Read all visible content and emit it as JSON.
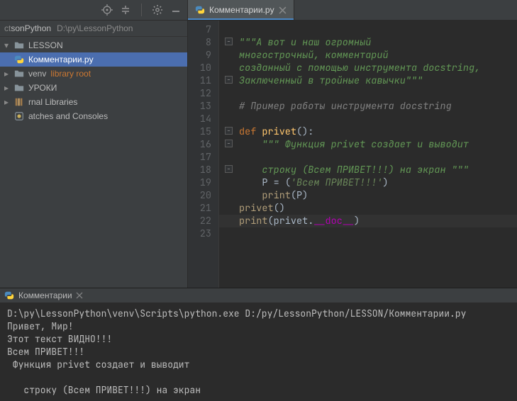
{
  "toolbar": {
    "icons": [
      "target-icon",
      "collapse-icon",
      "divider",
      "gear-icon",
      "minimize-icon"
    ]
  },
  "breadcrumb": {
    "prefix": "ct ",
    "project": "sonPython",
    "path": "D:\\py\\LessonPython"
  },
  "tree": {
    "items": [
      {
        "kind": "folder",
        "label": "LESSON",
        "arrow": "▾"
      },
      {
        "kind": "pyfile",
        "label": "Комментарии.py",
        "selected": true
      },
      {
        "kind": "venv",
        "label": "venv",
        "suffix": "library root",
        "arrow": "▸"
      },
      {
        "kind": "folder",
        "label": "УРОКИ",
        "arrow": "▸"
      },
      {
        "kind": "lib",
        "label": "rnal Libraries",
        "arrow": "▸"
      },
      {
        "kind": "scratch",
        "label": "atches and Consoles"
      }
    ]
  },
  "tab": {
    "label": "Комментарии.py"
  },
  "gutter_start": 7,
  "code_lines": [
    {
      "n": 7,
      "tokens": []
    },
    {
      "n": 8,
      "fold": "-",
      "tokens": [
        [
          "docstr",
          "\"\"\"А вот и наш огромный"
        ]
      ]
    },
    {
      "n": 9,
      "tokens": [
        [
          "docstr",
          "многострочный, комментарий"
        ]
      ]
    },
    {
      "n": 10,
      "tokens": [
        [
          "docstr",
          "созданный с помощью инструмента docstring,"
        ]
      ]
    },
    {
      "n": 11,
      "fold": "-",
      "tokens": [
        [
          "docstr",
          "Заключенный в тройные кавычки\"\"\""
        ]
      ]
    },
    {
      "n": 12,
      "tokens": []
    },
    {
      "n": 13,
      "tokens": [
        [
          "comment",
          "# Пример работы инструмента docstring"
        ]
      ]
    },
    {
      "n": 14,
      "tokens": []
    },
    {
      "n": 15,
      "fold": "-",
      "tokens": [
        [
          "kw",
          "def "
        ],
        [
          "fn",
          "privet"
        ],
        [
          "punct",
          "():"
        ]
      ]
    },
    {
      "n": 16,
      "fold": "-",
      "indent": 1,
      "tokens": [
        [
          "docstr",
          "\"\"\" Функция privet создает и выводит"
        ]
      ]
    },
    {
      "n": 17,
      "indent": 1,
      "tokens": []
    },
    {
      "n": 18,
      "fold": "-",
      "indent": 1,
      "tokens": [
        [
          "docstr",
          "строку (Всем ПРИВЕТ!!!) на экран \"\"\""
        ]
      ]
    },
    {
      "n": 19,
      "indent": 1,
      "tokens": [
        [
          "var",
          "P"
        ],
        [
          "punct",
          " = ("
        ],
        [
          "str",
          "'Всем ПРИВЕТ!!!'"
        ],
        [
          "punct",
          ")"
        ]
      ]
    },
    {
      "n": 20,
      "indent": 1,
      "tokens": [
        [
          "call",
          "print"
        ],
        [
          "punct",
          "("
        ],
        [
          "var",
          "P"
        ],
        [
          "punct",
          ")"
        ]
      ]
    },
    {
      "n": 21,
      "tokens": [
        [
          "call",
          "privet"
        ],
        [
          "punct",
          "()"
        ]
      ]
    },
    {
      "n": 22,
      "hl": true,
      "tokens": [
        [
          "call",
          "print"
        ],
        [
          "punct",
          "("
        ],
        [
          "var",
          "privet."
        ],
        [
          "mag",
          "__doc__"
        ],
        [
          "punct",
          ")"
        ]
      ]
    },
    {
      "n": 23,
      "tokens": []
    }
  ],
  "console": {
    "tab_label": "Комментарии",
    "lines": [
      "D:\\py\\LessonPython\\venv\\Scripts\\python.exe D:/py/LessonPython/LESSON/Комментарии.py",
      "Привет, Мир!",
      "Этот текст ВИДНО!!!",
      "Всем ПРИВЕТ!!!",
      " Функция privet создает и выводит",
      "",
      "   строку (Всем ПРИВЕТ!!!) на экран "
    ]
  }
}
